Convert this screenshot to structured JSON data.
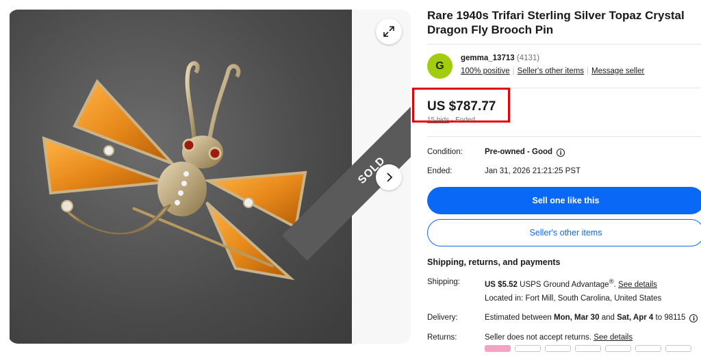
{
  "gallery": {
    "sold_label": "SOLD",
    "expand_icon": "expand-icon",
    "next_icon": "chevron-right-icon"
  },
  "listing": {
    "title": "Rare 1940s Trifari Sterling Silver Topaz Crystal Dragon Fly Brooch Pin"
  },
  "seller": {
    "avatar_letter": "G",
    "avatar_color": "#a2cd0f",
    "username": "gemma_13713",
    "feedback_count": "(4131)",
    "positive": "100% positive",
    "other_items_link": "Seller's other items",
    "message_link": "Message seller"
  },
  "price": {
    "amount": "US $787.77",
    "bids": "15 bids",
    "status": "Ended",
    "highlight_color": "#e60000"
  },
  "details": {
    "condition_label": "Condition:",
    "condition_value": "Pre-owned - Good",
    "ended_label": "Ended:",
    "ended_value": "Jan 31, 2026 21:21:25 PST"
  },
  "actions": {
    "primary": "Sell one like this",
    "secondary": "Seller's other items",
    "primary_color": "#0968f6"
  },
  "shipping": {
    "section_title": "Shipping, returns, and payments",
    "shipping_label": "Shipping:",
    "shipping_price": "US $5.52",
    "shipping_service": "USPS Ground Advantage",
    "shipping_mark": "®",
    "see_details": "See details",
    "location": "Located in: Fort Mill, South Carolina, United States",
    "delivery_label": "Delivery:",
    "delivery_prefix": "Estimated between",
    "delivery_start": "Mon, Mar 30",
    "delivery_and": "and",
    "delivery_end": "Sat, Apr 4",
    "delivery_suffix": "to 98115",
    "returns_label": "Returns:",
    "returns_value": "Seller does not accept returns.",
    "returns_link": "See details"
  }
}
